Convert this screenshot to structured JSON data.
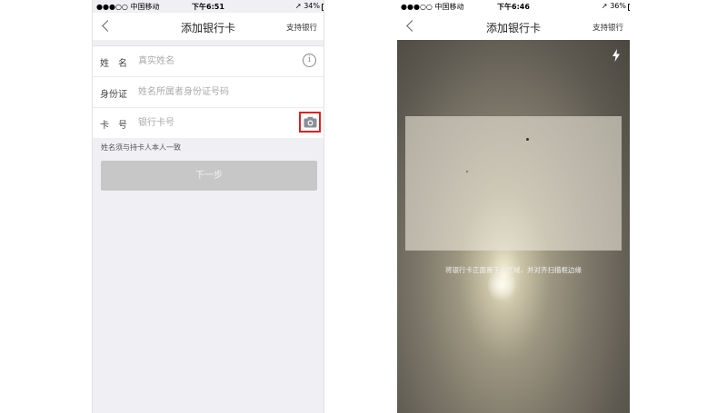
{
  "left": {
    "status_bar": {
      "carrier": "●●●○○ 中国移动",
      "time": "下午6:51",
      "battery": "34%",
      "battery_level": 0.34
    },
    "nav": {
      "title": "添加银行卡",
      "right": "支持银行"
    },
    "form": {
      "name": {
        "label": "姓　名",
        "placeholder": "真实姓名"
      },
      "id": {
        "label": "身份证",
        "placeholder": "姓名所属者身份证号码"
      },
      "card": {
        "label": "卡　号",
        "placeholder": "银行卡号"
      }
    },
    "hint": "姓名须与持卡人本人一致",
    "next_button": "下一步"
  },
  "right": {
    "status_bar": {
      "carrier": "●●●○○ 中国移动",
      "time": "下午6:46",
      "battery": "36%",
      "battery_level": 0.36
    },
    "nav": {
      "title": "添加银行卡",
      "right": "支持银行"
    },
    "scan_hint": "将银行卡正面置于此区域，并对齐扫描框边缘"
  },
  "icons": {
    "info": "info-icon",
    "camera": "camera-icon",
    "flash": "flash-icon",
    "back": "back-arrow-icon"
  },
  "colors": {
    "highlight": "#e02020",
    "button_disabled": "#c7c7c7",
    "background": "#efeff4"
  }
}
